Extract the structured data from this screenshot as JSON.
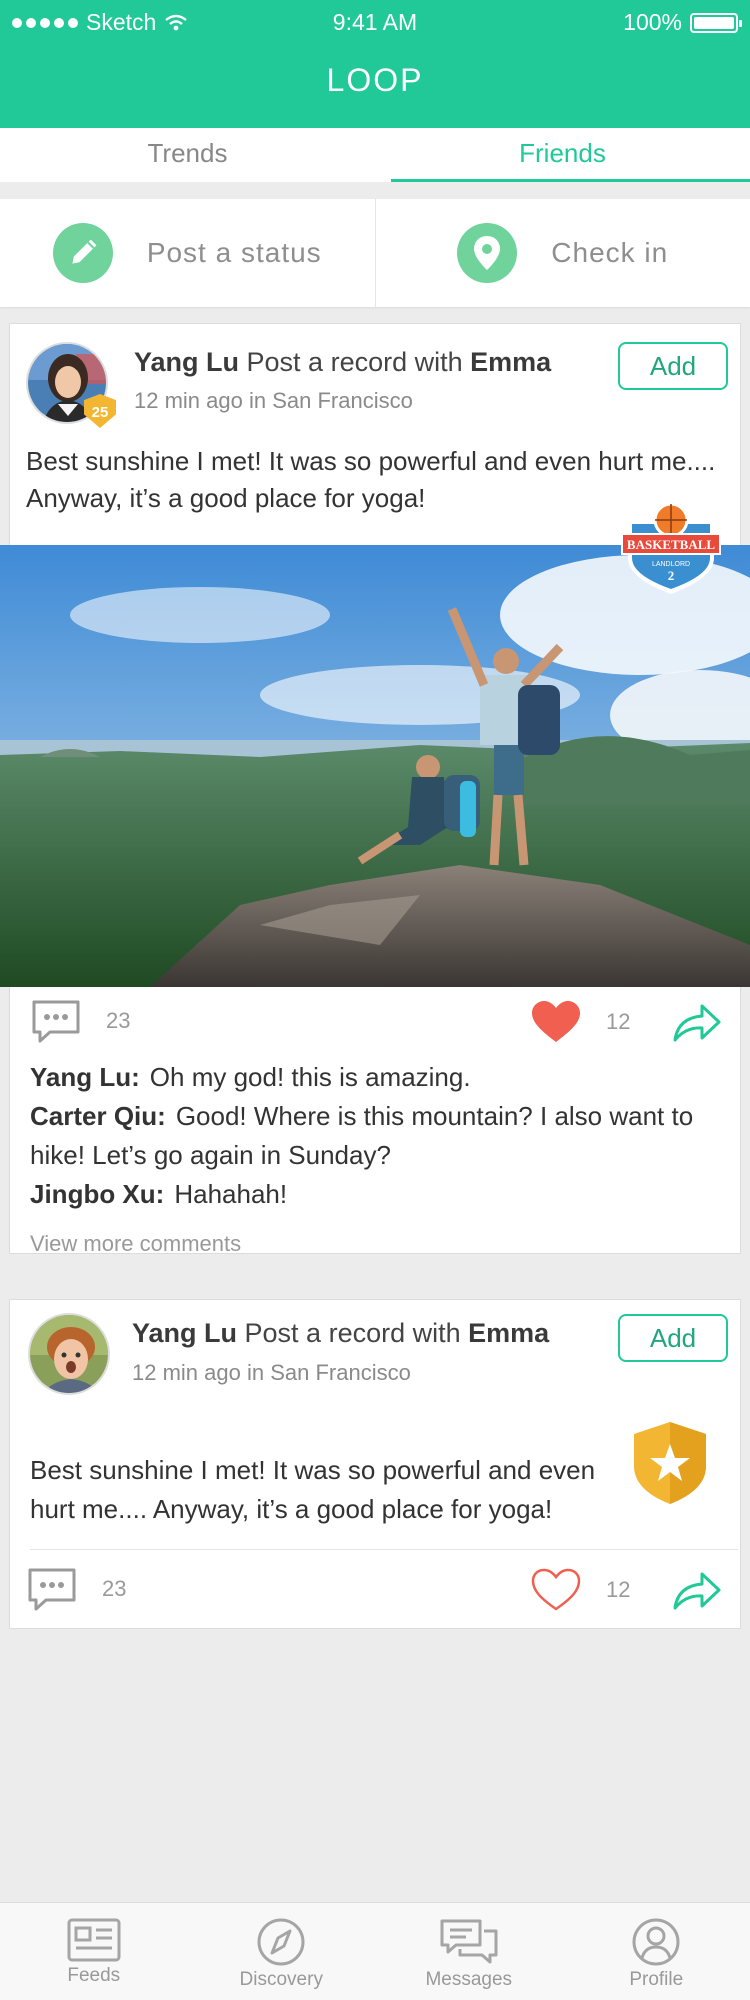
{
  "status_bar": {
    "carrier": "Sketch",
    "time": "9:41 AM",
    "battery": "100%"
  },
  "app": {
    "title": "LOOP"
  },
  "tabs": [
    {
      "label": "Trends",
      "active": false
    },
    {
      "label": "Friends",
      "active": true
    }
  ],
  "actions": {
    "post_status": "Post a status",
    "check_in": "Check in"
  },
  "colors": {
    "brand": "#20c997",
    "heart": "#f05f4f",
    "badge_gold": "#f2b632"
  },
  "posts": [
    {
      "author": "Yang Lu",
      "action": "Post a record with",
      "partner": "Emma",
      "meta": "12 min ago in San Francisco",
      "add_label": "Add",
      "level": "25",
      "text": "Best sunshine I met! It was so powerful and even hurt me.... Anyway, it’s a good place for yoga!",
      "badge": {
        "line1": "BASKETBALL",
        "line2": "LANDLORD",
        "line3": "2"
      },
      "comment_count": "23",
      "like_count": "12",
      "liked": true,
      "comments": [
        {
          "author": "Yang Lu:",
          "text": "Oh my god! this is amazing."
        },
        {
          "author": "Carter Qiu:",
          "text": "Good! Where is this mountain? I also want to hike! Let’s go again in Sunday?"
        },
        {
          "author": "Jingbo Xu:",
          "text": "Hahahah!"
        }
      ],
      "view_more": "View more comments"
    },
    {
      "author": "Yang Lu",
      "action": "Post a record with",
      "partner": "Emma",
      "meta": "12 min ago in San Francisco",
      "add_label": "Add",
      "text": "Best sunshine I met! It was so powerful and even hurt me.... Anyway, it’s a good place for yoga!",
      "comment_count": "23",
      "like_count": "12",
      "liked": false
    }
  ],
  "nav": [
    {
      "label": "Feeds",
      "icon": "feeds-icon"
    },
    {
      "label": "Discovery",
      "icon": "compass-icon"
    },
    {
      "label": "Messages",
      "icon": "messages-icon"
    },
    {
      "label": "Profile",
      "icon": "profile-icon"
    }
  ]
}
